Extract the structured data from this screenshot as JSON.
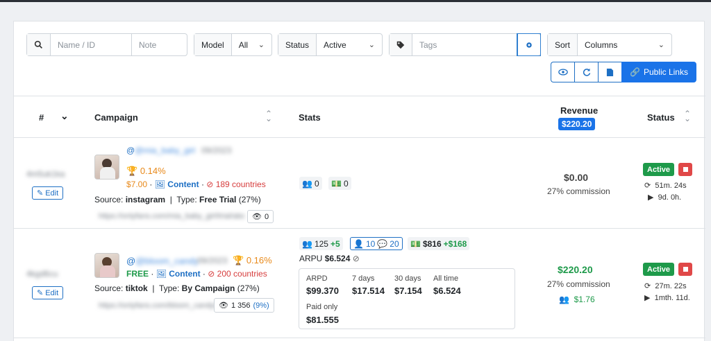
{
  "filters": {
    "search_placeholder": "Name / ID",
    "note_placeholder": "Note",
    "model_label": "Model",
    "model_value": "All",
    "status_label": "Status",
    "status_value": "Active",
    "tags_placeholder": "Tags",
    "sort_label": "Sort",
    "sort_value": "Columns"
  },
  "actions": {
    "public_links": "Public Links"
  },
  "table": {
    "col_num": "#",
    "col_campaign": "Campaign",
    "col_stats": "Stats",
    "col_revenue": "Revenue",
    "revenue_total": "$220.20",
    "col_status": "Status"
  },
  "rows": [
    {
      "id_blur": "4m5uk1ka",
      "edit": "Edit",
      "handle": "@mia_baby_girl",
      "handle_date": "09/2023",
      "rank": "0.14%",
      "price": "$7.00",
      "content": "Content",
      "countries": "189 countries",
      "source_label": "Source:",
      "source": "instagram",
      "type_label": "Type:",
      "type": "Free Trial",
      "type_pct": "(27%)",
      "link_blur": "https://onlyfans.com/mia_baby_girl/trial/abc",
      "views": "0",
      "subs": "0",
      "money_count": "0",
      "revenue": "$0.00",
      "commission": "27% commission",
      "status": "Active",
      "timer1": "51m. 24s",
      "timer2": "9d. 0h."
    },
    {
      "id_blur": "4kgd6cu",
      "edit": "Edit",
      "handle": "@bloom_candy",
      "handle_date": "09/2023",
      "rank": "0.16%",
      "price": "FREE",
      "content": "Content",
      "countries": "200 countries",
      "source_label": "Source:",
      "source": "tiktok",
      "type_label": "Type:",
      "type": "By Campaign",
      "type_pct": "(27%)",
      "link_blur": "https://onlyfans.com/bloom_candy/c",
      "views": "1 356",
      "views_pct": "(9%)",
      "subs": "125",
      "subs_delta": "+5",
      "active_subs": "10",
      "messages": "20",
      "money": "$816",
      "money_delta": "+$168",
      "arpu_label": "ARPU",
      "arpu": "$6.524",
      "arpd_label": "ARPD",
      "arpd": "$99.370",
      "d7_label": "7 days",
      "d7": "$17.514",
      "d30_label": "30 days",
      "d30": "$7.154",
      "all_label": "All time",
      "all": "$6.524",
      "paid_label": "Paid only",
      "paid": "$81.555",
      "revenue": "$220.20",
      "commission": "27% commission",
      "fan_value": "$1.76",
      "status": "Active",
      "timer1": "27m. 22s",
      "timer2": "1mth. 11d."
    }
  ],
  "colors": {
    "primary": "#1a73e8",
    "success": "#1e9a4a",
    "danger": "#e04848",
    "warning": "#e8891a"
  }
}
